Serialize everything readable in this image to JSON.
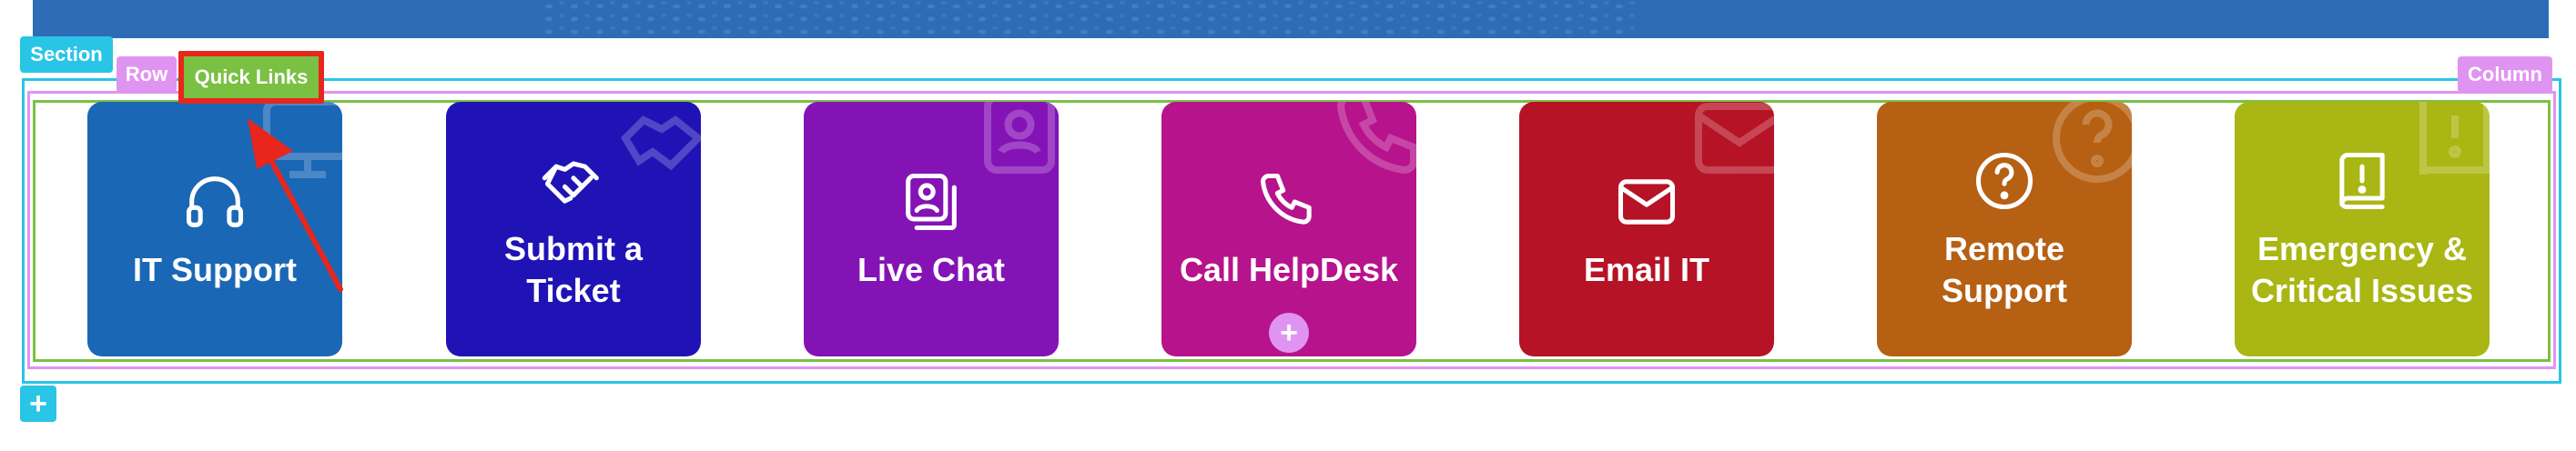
{
  "builder": {
    "section_tag": "Section",
    "row_tag": "Row",
    "column_tag": "Column",
    "module_tag": "Quick Links",
    "add_section_symbol": "+",
    "add_module_symbol": "+"
  },
  "quick_links": [
    {
      "label": "IT Support",
      "icon": "headphones-icon",
      "color": "#1a67b6"
    },
    {
      "label": "Submit a Ticket",
      "icon": "handshake-icon",
      "color": "#1f13b6"
    },
    {
      "label": "Live Chat",
      "icon": "chat-contact-icon",
      "color": "#8413b6"
    },
    {
      "label": "Call HelpDesk",
      "icon": "phone-icon",
      "color": "#b6138c"
    },
    {
      "label": "Email IT",
      "icon": "envelope-icon",
      "color": "#b61326"
    },
    {
      "label": "Remote Support",
      "icon": "question-circle-icon",
      "color": "#b66013"
    },
    {
      "label": "Emergency & Critical Issues",
      "icon": "exclamation-book-icon",
      "color": "#a9b613"
    }
  ],
  "colors": {
    "section_outline": "#29c5e6",
    "row_outline": "#e094f2",
    "column_outline": "#7ac043",
    "highlight": "#e8261d",
    "hero": "#2e6cb6"
  }
}
